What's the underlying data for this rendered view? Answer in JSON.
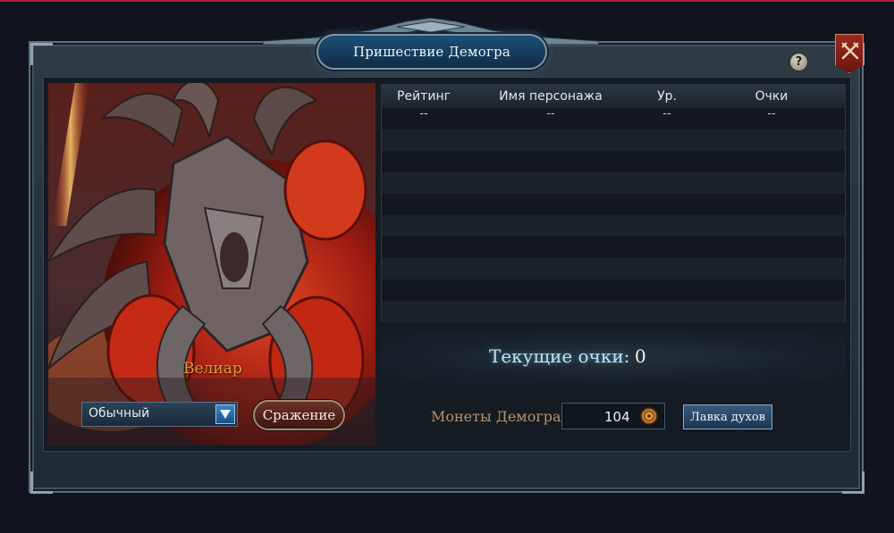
{
  "window": {
    "title": "Пришествие Демогра",
    "help_icon": "?",
    "close_icon": "crossed-swords-icon"
  },
  "boss": {
    "name": "Велиар",
    "portrait": "demon-boss-portrait"
  },
  "controls": {
    "mode_selected": "Обычный",
    "battle_label": "Сражение"
  },
  "ranking": {
    "headers": [
      "Рейтинг",
      "Имя персонажа",
      "Ур.",
      "Очки"
    ],
    "rows": [
      [
        "--",
        "--",
        "--",
        "--"
      ],
      [
        "",
        "",
        "",
        ""
      ],
      [
        "",
        "",
        "",
        ""
      ],
      [
        "",
        "",
        "",
        ""
      ],
      [
        "",
        "",
        "",
        ""
      ],
      [
        "",
        "",
        "",
        ""
      ],
      [
        "",
        "",
        "",
        ""
      ],
      [
        "",
        "",
        "",
        ""
      ],
      [
        "",
        "",
        "",
        ""
      ],
      [
        "",
        "",
        "",
        ""
      ]
    ]
  },
  "score": {
    "label": "Текущие очки:",
    "value": "0"
  },
  "coins": {
    "label": "Монеты Демогра",
    "value": "104",
    "icon": "demogor-coin-icon"
  },
  "shop": {
    "label": "Лавка духов"
  },
  "colors": {
    "accent_top_line": "#b3193f",
    "boss_name": "#d9a23a",
    "score_label": "#bfe3f5",
    "coins_label": "#b9916a"
  }
}
